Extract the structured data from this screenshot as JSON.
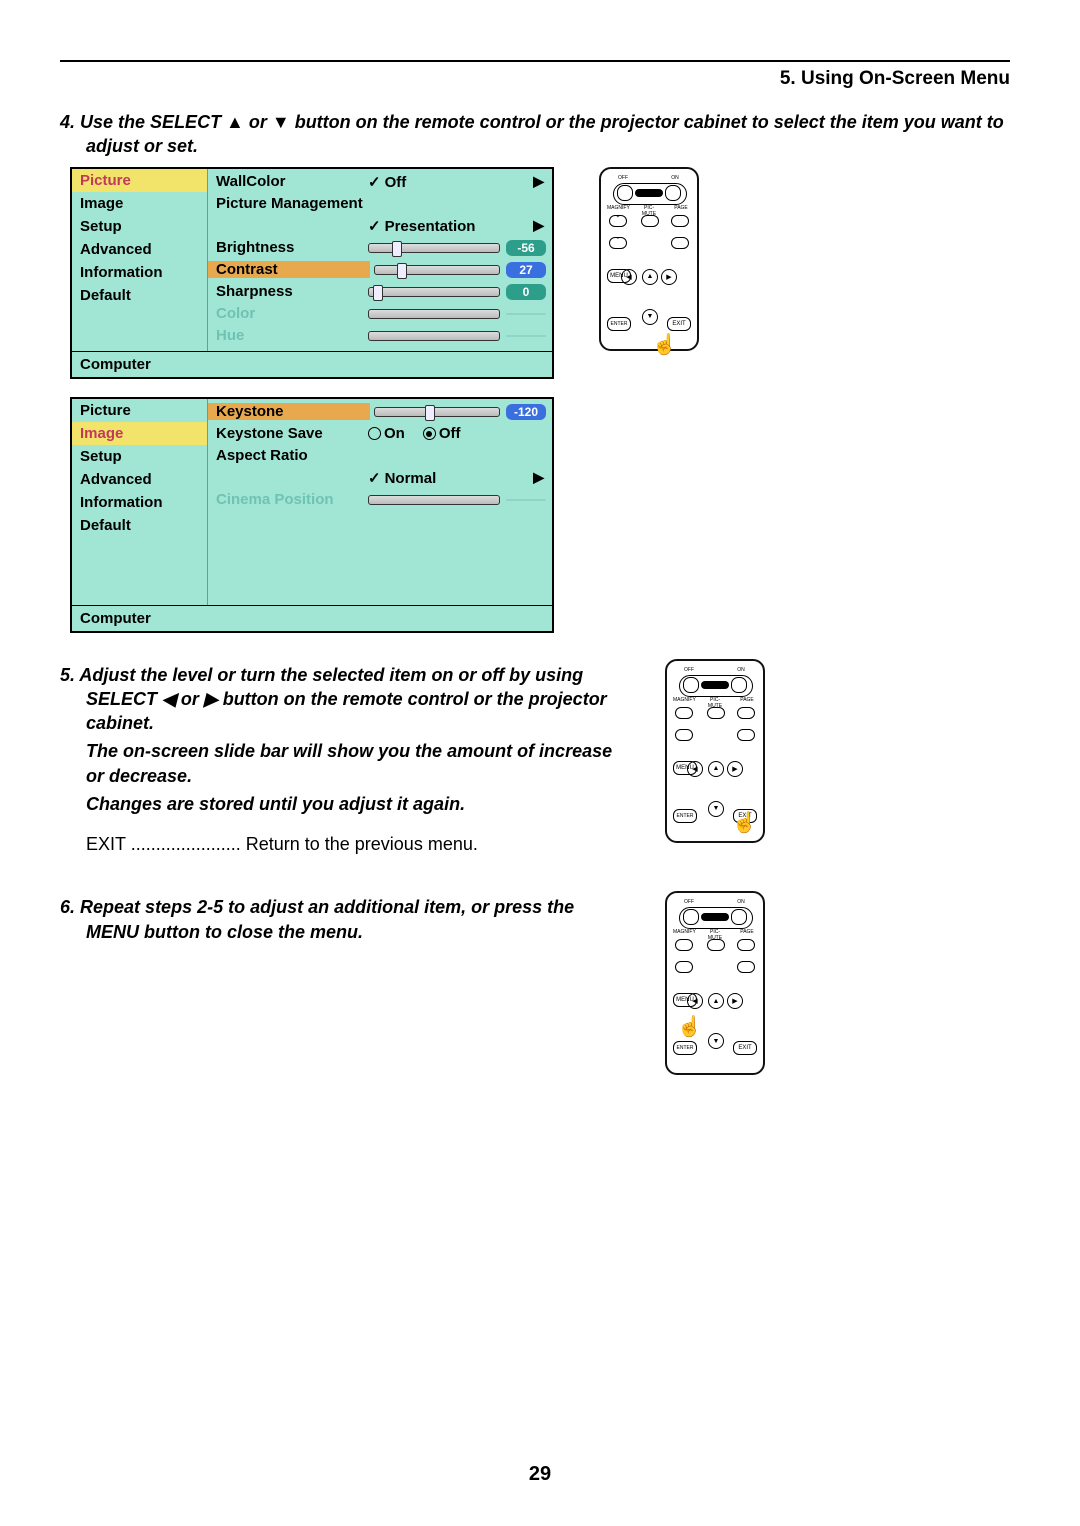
{
  "header": "5. Using On-Screen Menu",
  "page_number": "29",
  "step4": {
    "num": "4.",
    "text": "Use the SELECT ▲ or ▼ button on the remote control or the projector cabinet to select the item you want to adjust or set."
  },
  "osd1": {
    "sidebar": [
      "Picture",
      "Image",
      "Setup",
      "Advanced",
      "Information",
      "Default"
    ],
    "sidebar_selected": 0,
    "rows": {
      "wallcolor": {
        "label": "WallColor",
        "value": "Off"
      },
      "picmgmt": {
        "label": "Picture Management",
        "value": "Presentation"
      },
      "brightness": {
        "label": "Brightness",
        "value": "-56",
        "thumb_pct": 18
      },
      "contrast": {
        "label": "Contrast",
        "value": "27",
        "thumb_pct": 18,
        "selected": true
      },
      "sharpness": {
        "label": "Sharpness",
        "value": "0",
        "thumb_pct": 3
      },
      "color": {
        "label": "Color"
      },
      "hue": {
        "label": "Hue"
      }
    },
    "status": "Computer"
  },
  "osd2": {
    "sidebar": [
      "Picture",
      "Image",
      "Setup",
      "Advanced",
      "Information",
      "Default"
    ],
    "sidebar_selected": 1,
    "rows": {
      "keystone": {
        "label": "Keystone",
        "value": "-120",
        "thumb_pct": 40,
        "selected": true
      },
      "keystonesave": {
        "label": "Keystone Save",
        "on": "On",
        "off": "Off",
        "selected": "off"
      },
      "aspect": {
        "label": "Aspect Ratio",
        "value": "Normal"
      },
      "cinema": {
        "label": "Cinema Position"
      }
    },
    "status": "Computer"
  },
  "step5": {
    "num": "5.",
    "line1": "Adjust the level or turn the selected item on or off by using SELECT ◀ or ▶ button on the remote control or the projector cabinet.",
    "line2": "The on-screen slide bar will show you the amount of increase or decrease.",
    "line3": "Changes are stored until you adjust it again."
  },
  "exit_line": {
    "label": "EXIT",
    "dots": " ...................... ",
    "text": "Return to the previous menu."
  },
  "step6": {
    "num": "6.",
    "text": "Repeat steps 2-5 to adjust an additional item, or press the MENU button to close the menu."
  },
  "remote": {
    "off": "OFF",
    "on": "ON",
    "power": "POWER",
    "magnify": "MAGNIFY",
    "picmute": "PIC-MUTE",
    "page": "PAGE",
    "up": "UP",
    "down": "DOWN",
    "menu": "MENU",
    "enter": "ENTER",
    "exit": "EXIT",
    "plus": "+",
    "minus": "−"
  }
}
